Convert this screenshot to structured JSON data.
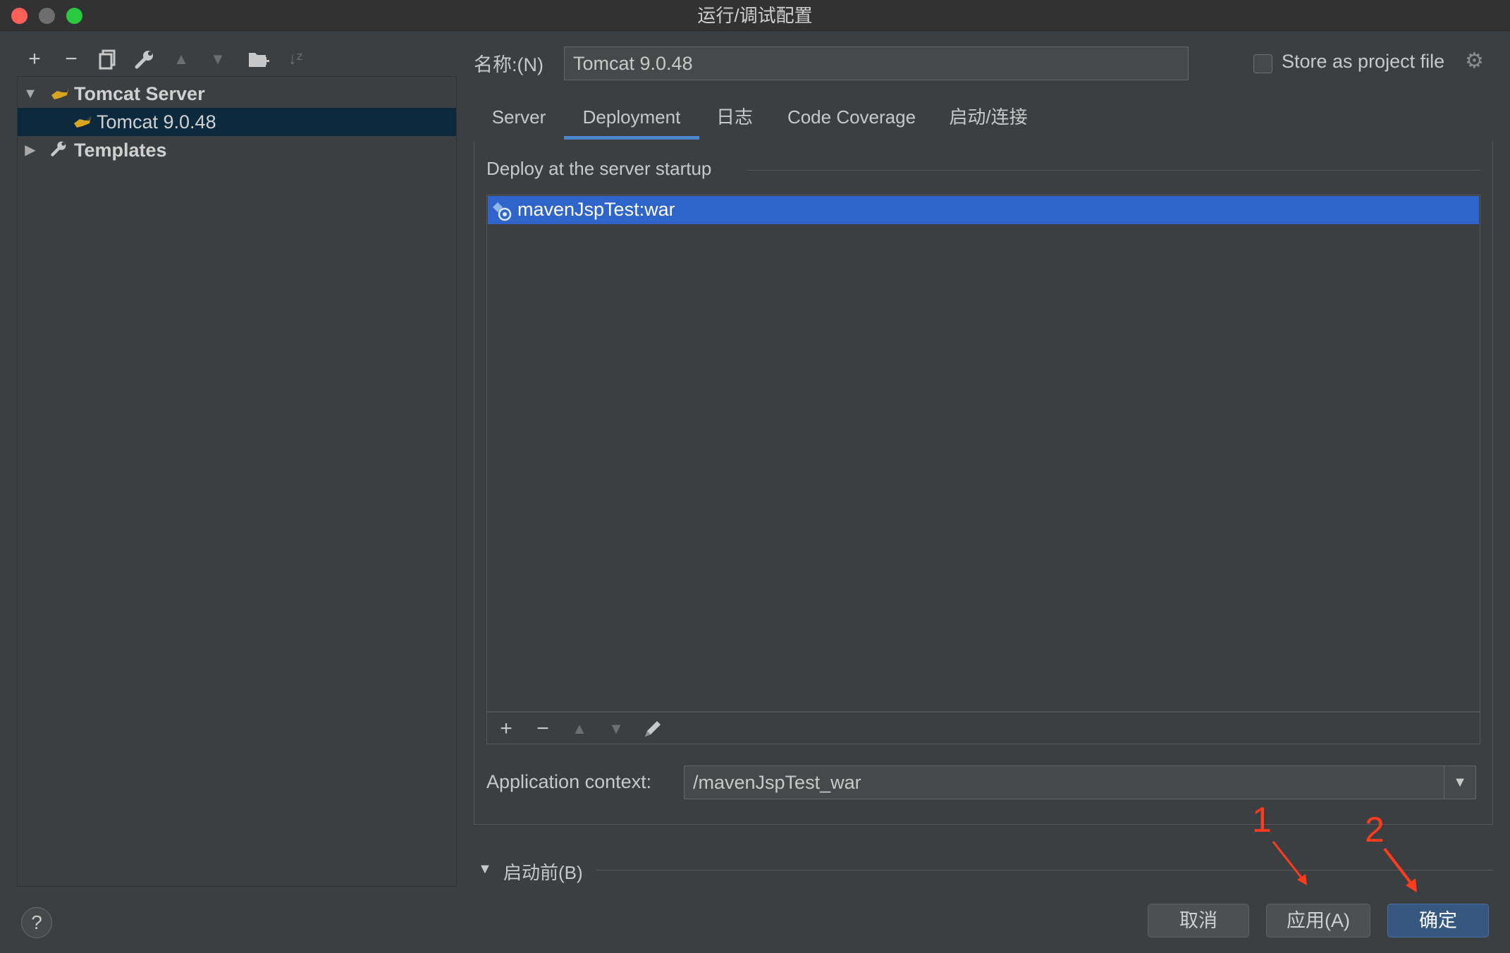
{
  "window": {
    "title": "运行/调试配置",
    "traffic_lights": [
      "#fe5f57",
      "#6e6e6e",
      "#29c940"
    ]
  },
  "left_toolbar": {
    "icons": [
      "plus-icon",
      "minus-icon",
      "copy-icon",
      "wrench-icon",
      "arrow-up-icon",
      "arrow-down-icon",
      "new-folder-icon",
      "sort-icon"
    ]
  },
  "tree": {
    "items": [
      {
        "label": "Tomcat Server",
        "expanded": true
      },
      {
        "label": "Tomcat 9.0.48",
        "selected": true
      },
      {
        "label": "Templates",
        "expanded": false
      }
    ]
  },
  "header": {
    "name_label": "名称:(N)",
    "name_value": "Tomcat 9.0.48",
    "store_label": "Store as project file",
    "store_checked": false
  },
  "tabs": [
    {
      "label": "Server",
      "active": false
    },
    {
      "label": "Deployment",
      "active": true
    },
    {
      "label": "日志",
      "active": false
    },
    {
      "label": "Code Coverage",
      "active": false
    },
    {
      "label": "启动/连接",
      "active": false
    }
  ],
  "deployment": {
    "section_title": "Deploy at the server startup",
    "items": [
      {
        "label": "mavenJspTest:war",
        "selected": true
      }
    ],
    "context_label": "Application context:",
    "context_value": "/mavenJspTest_war"
  },
  "before_launch": {
    "label": "启动前(B)",
    "expanded": true
  },
  "buttons": {
    "help": "?",
    "cancel": "取消",
    "apply": "应用(A)",
    "ok": "确定"
  },
  "annotations": {
    "one": "1",
    "two": "2",
    "color": "#ff3b1f"
  },
  "colors": {
    "accent": "#4a88c7",
    "selection": "#2f65ca",
    "tree_selection": "#0d293e",
    "primary_button": "#365880"
  }
}
